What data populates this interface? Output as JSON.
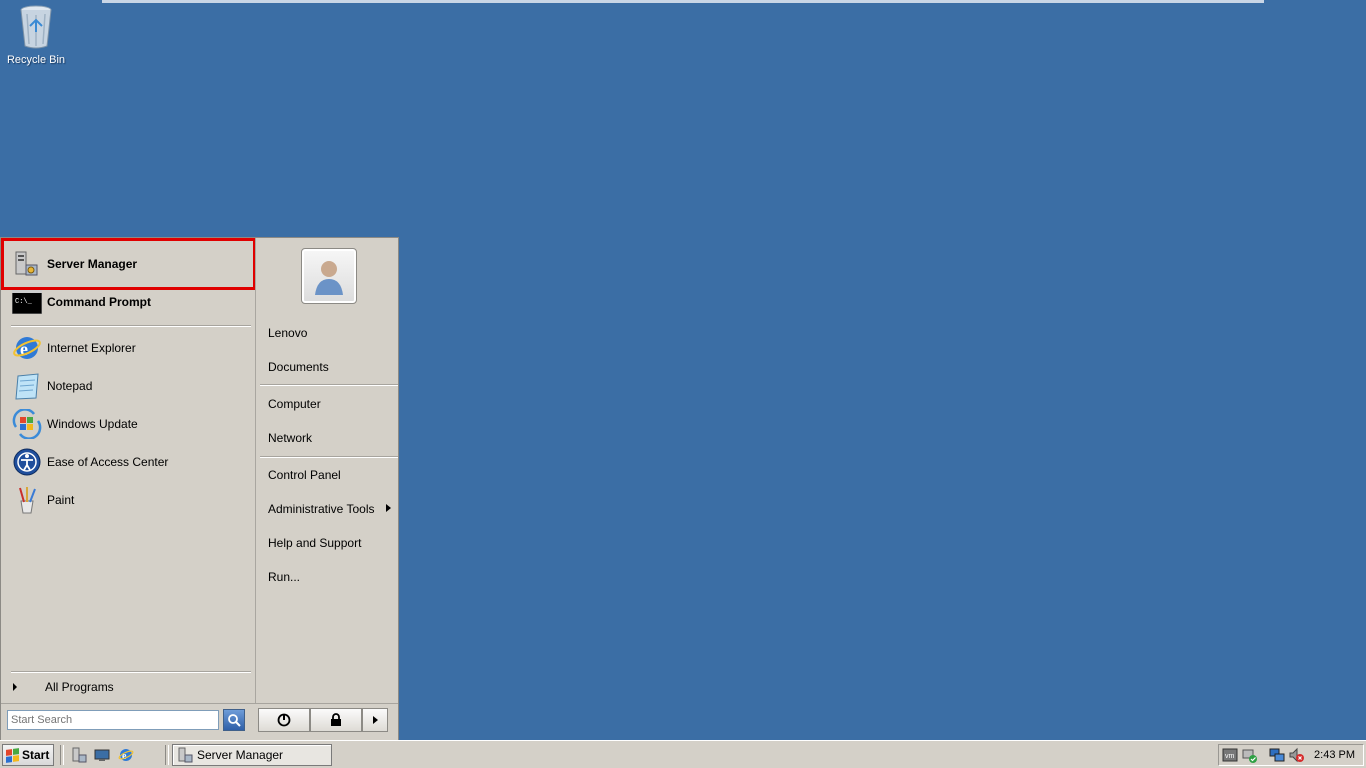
{
  "desktop": {
    "recycle_bin_label": "Recycle Bin"
  },
  "start_menu": {
    "pinned": [
      {
        "label": "Server Manager",
        "icon": "server-manager-icon"
      },
      {
        "label": "Command Prompt",
        "icon": "command-prompt-icon"
      }
    ],
    "recent": [
      {
        "label": "Internet Explorer",
        "icon": "internet-explorer-icon"
      },
      {
        "label": "Notepad",
        "icon": "notepad-icon"
      },
      {
        "label": "Windows Update",
        "icon": "windows-update-icon"
      },
      {
        "label": "Ease of Access Center",
        "icon": "ease-of-access-icon"
      },
      {
        "label": "Paint",
        "icon": "paint-icon"
      }
    ],
    "all_programs_label": "All Programs",
    "search_placeholder": "Start Search",
    "right_items": [
      {
        "label": "Lenovo"
      },
      {
        "label": "Documents"
      },
      {
        "label": "Computer"
      },
      {
        "label": "Network"
      },
      {
        "label": "Control Panel"
      },
      {
        "label": "Administrative Tools"
      },
      {
        "label": "Help and Support"
      },
      {
        "label": "Run..."
      }
    ],
    "highlight_color": "#e00000"
  },
  "taskbar": {
    "start_label": "Start",
    "task_button_label": "Server Manager",
    "clock": "2:43 PM"
  },
  "colors": {
    "desktop_background": "#3b6ea5",
    "menu_background": "#d4d0c8"
  }
}
